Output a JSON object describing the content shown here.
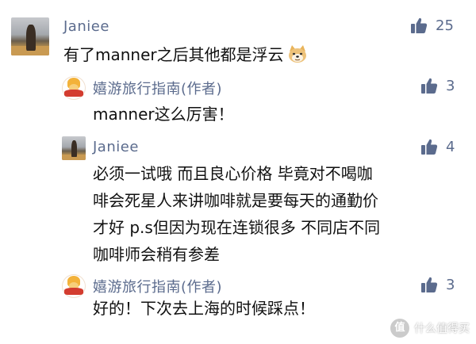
{
  "comments": [
    {
      "username": "Janiee",
      "content_lines": [
        "有了manner之后其他都是浮云"
      ],
      "emoji": "doge-emoji",
      "likes": "25"
    },
    {
      "username": "嬉游旅行指南(作者)",
      "content_lines": [
        "manner这么厉害！"
      ],
      "likes": "3"
    },
    {
      "username": "Janiee",
      "content_lines": [
        "必须一试哦 而且良心价格 毕竟对不喝咖",
        "啡会死星人来讲咖啡就是要每天的通勤价",
        "才好 p.s但因为现在连锁很多 不同店不同",
        "咖啡师会稍有参差"
      ],
      "likes": "4"
    },
    {
      "username": "嬉游旅行指南(作者)",
      "content_lines": [
        "好的！下次去上海的时候踩点！"
      ],
      "likes": "3"
    }
  ],
  "watermark": {
    "icon_text": "值",
    "text": "什么值得买"
  },
  "colors": {
    "username": "#5b6b8d",
    "like_icon": "#5b6b8d",
    "content": "#111111"
  },
  "icons": {
    "like": "thumbs-up-icon",
    "emoji": "doge-emoji",
    "avatar_janiee": "avatar-photo",
    "avatar_guide": "avatar-cartoon"
  }
}
